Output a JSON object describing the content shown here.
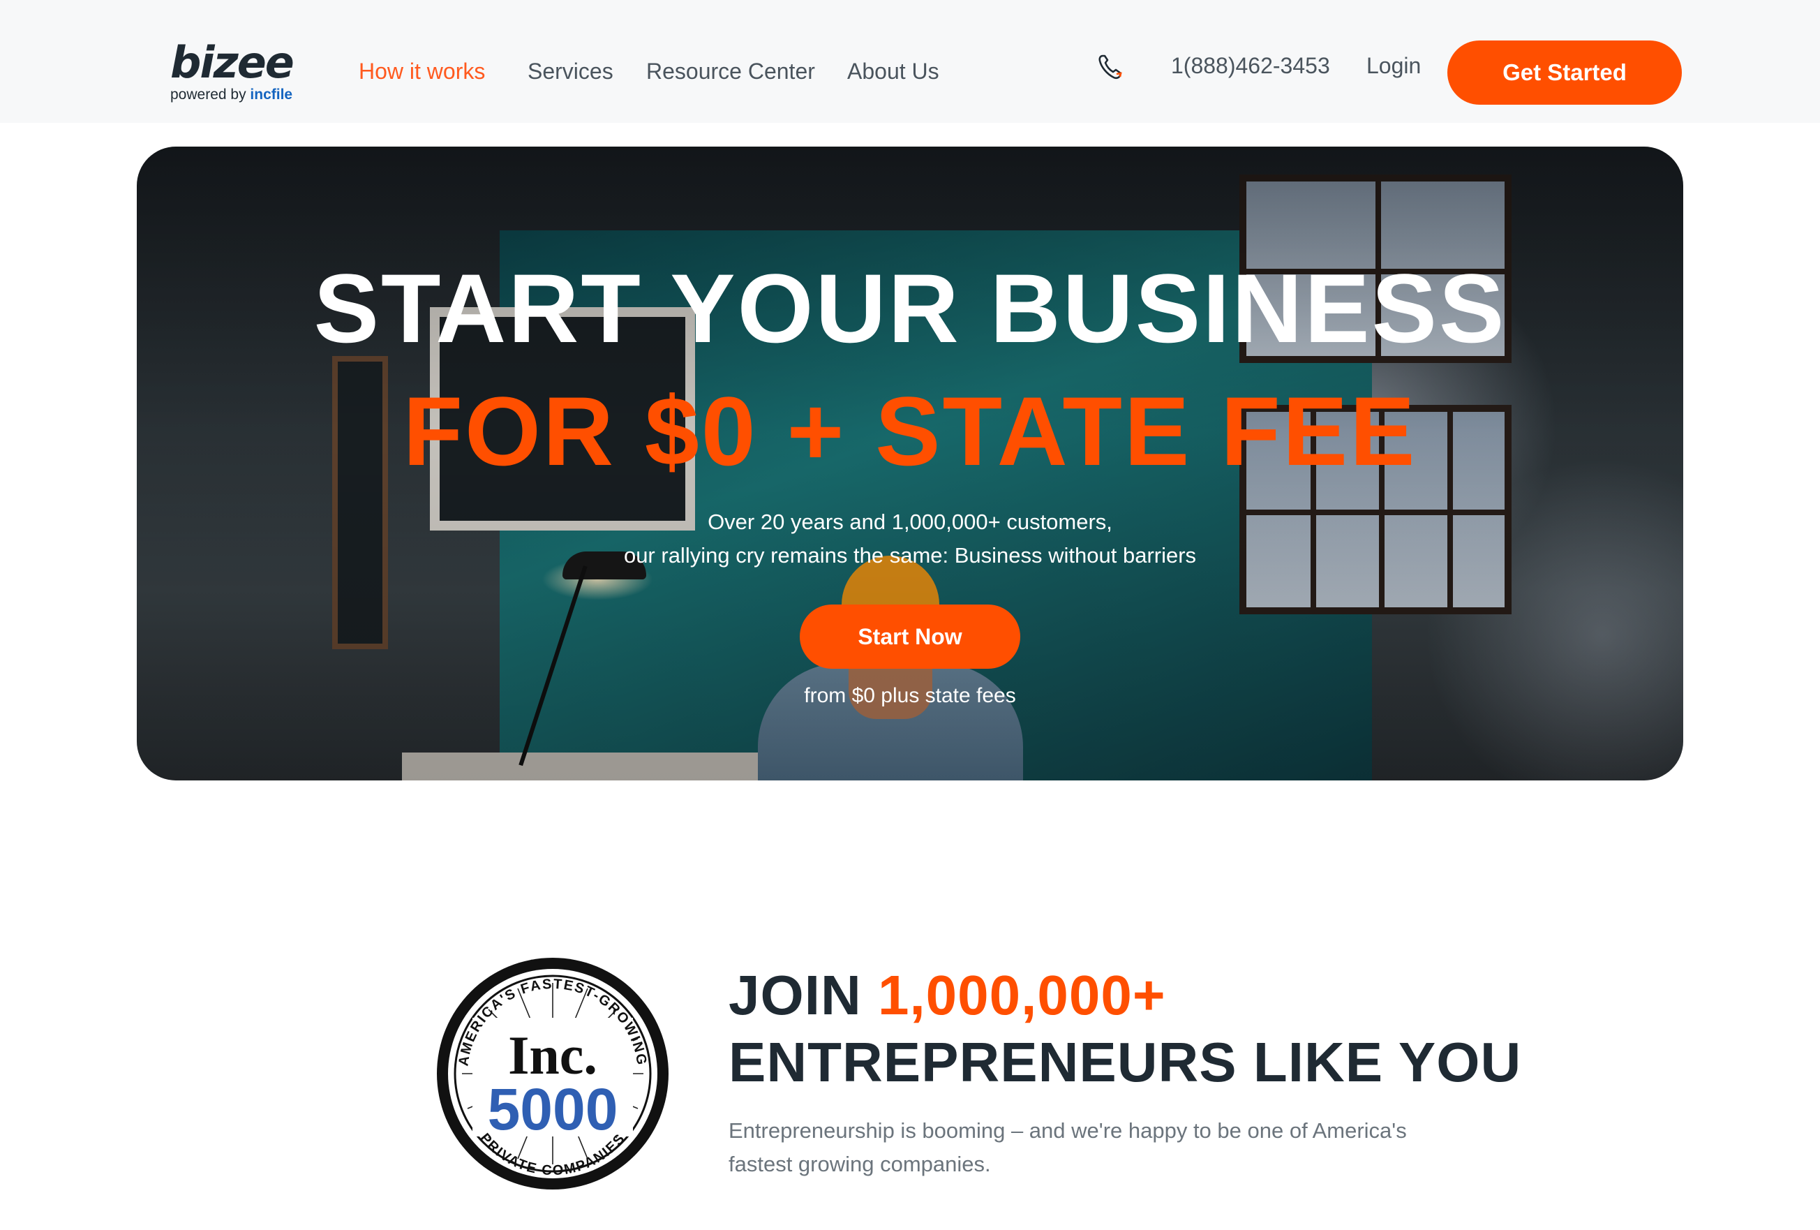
{
  "brand": {
    "logo_text": "bizee",
    "powered_by": "powered by",
    "parent": "incfile"
  },
  "nav": {
    "links": [
      "How it works",
      "Services",
      "Resource Center",
      "About Us"
    ],
    "active": "How it works",
    "phone": "1(888)462-3453",
    "login": "Login",
    "cta": "Get Started"
  },
  "hero": {
    "title_line1": "START YOUR BUSINESS",
    "title_line2": "FOR $0 + STATE FEE",
    "subtitle_line1": "Over 20 years and 1,000,000+ customers,",
    "subtitle_line2": "our rallying cry remains the same: Business without barriers",
    "cta": "Start Now",
    "note": "from $0 plus state fees"
  },
  "join": {
    "badge": {
      "top_text": "AMERICA'S FASTEST-GROWING",
      "brand": "Inc.",
      "number": "5000",
      "bottom_text": "PRIVATE COMPANIES"
    },
    "heading_prefix": "JOIN ",
    "heading_accent": "1,000,000+",
    "heading_line2": "ENTREPRENEURS LIKE YOU",
    "description": "Entrepreneurship is booming – and we're happy to be one of America's fastest growing companies."
  },
  "colors": {
    "accent": "#ff4f00",
    "nav_bg": "#f7f8f9",
    "text_dark": "#1f2a33",
    "text_muted": "#6b747c",
    "incfile_blue": "#1565c0"
  }
}
